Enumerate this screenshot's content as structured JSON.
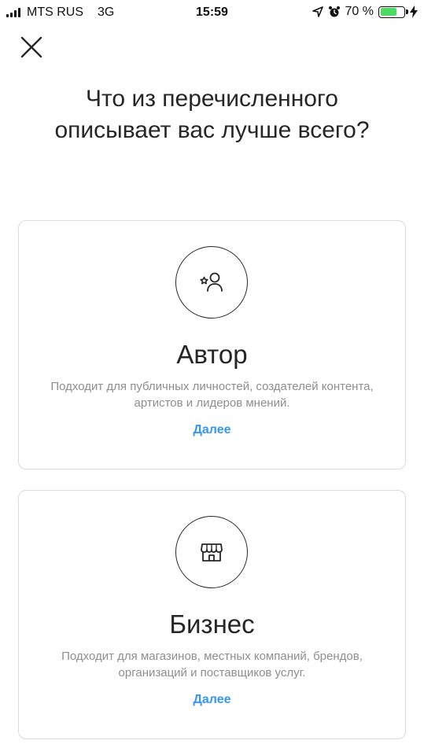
{
  "status_bar": {
    "carrier": "MTS RUS",
    "network": "3G",
    "time": "15:59",
    "battery_text": "70 %",
    "battery_level": 0.7,
    "battery_color": "#4cd964"
  },
  "header": {
    "close_icon": "close-icon"
  },
  "title": "Что из перечисленного описывает вас лучше всего?",
  "options": [
    {
      "icon": "creator-star-person-icon",
      "title": "Автор",
      "description": "Подходит для публичных личностей, создателей контента, артистов и лидеров мнений.",
      "link": "Далее"
    },
    {
      "icon": "storefront-icon",
      "title": "Бизнес",
      "description": "Подходит для магазинов, местных компаний, брендов, организаций и поставщиков услуг.",
      "link": "Далее"
    }
  ],
  "colors": {
    "link": "#3897f0",
    "text": "#262626",
    "secondary_text": "#8e8e8e",
    "border": "#dbdbdb"
  }
}
